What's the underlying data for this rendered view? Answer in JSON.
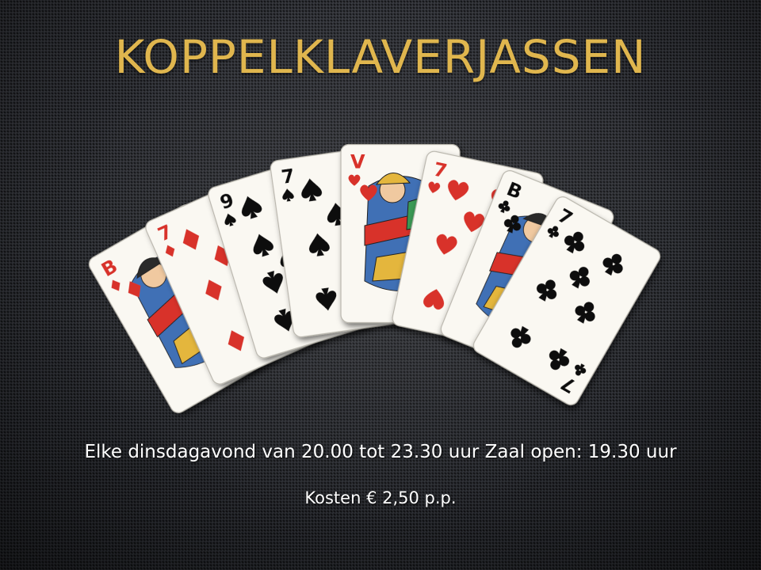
{
  "slide": {
    "title": "KOPPELKLAVERJASSEN",
    "schedule": "Elke dinsdagavond van 20.00  tot 23.30  uur Zaal open: 19.30  uur",
    "cost": "Kosten € 2,50 p.p."
  },
  "cards": [
    {
      "rank": "B",
      "suit": "diamonds",
      "color": "#d8332a"
    },
    {
      "rank": "7",
      "suit": "diamonds",
      "color": "#d8332a"
    },
    {
      "rank": "9",
      "suit": "spades",
      "color": "#111111"
    },
    {
      "rank": "7",
      "suit": "spades",
      "color": "#111111"
    },
    {
      "rank": "V",
      "suit": "hearts",
      "color": "#d8332a"
    },
    {
      "rank": "7",
      "suit": "hearts",
      "color": "#d8332a"
    },
    {
      "rank": "B",
      "suit": "clubs",
      "color": "#111111"
    },
    {
      "rank": "7",
      "suit": "clubs",
      "color": "#111111"
    }
  ],
  "colors": {
    "title": "#e0b64e",
    "text": "#ffffff",
    "background": "#2b2d33"
  }
}
